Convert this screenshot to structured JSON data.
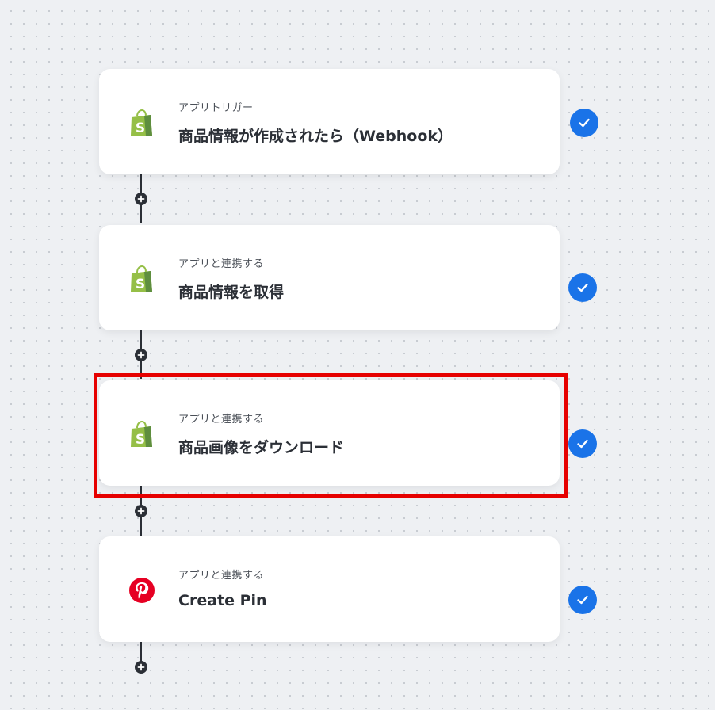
{
  "steps": [
    {
      "kind": "アプリトリガー",
      "title": "商品情報が作成されたら（Webhook）",
      "app_icon": "shopify-icon",
      "status": "completed"
    },
    {
      "kind": "アプリと連携する",
      "title": "商品情報を取得",
      "app_icon": "shopify-icon",
      "status": "completed"
    },
    {
      "kind": "アプリと連携する",
      "title": "商品画像をダウンロード",
      "app_icon": "shopify-icon",
      "status": "completed"
    },
    {
      "kind": "アプリと連携する",
      "title": "Create Pin",
      "app_icon": "pinterest-icon",
      "status": "completed"
    }
  ],
  "colors": {
    "check": "#1a73e8",
    "highlight": "#e60000",
    "shopify": "#95bf47",
    "pinterest": "#e60023"
  }
}
